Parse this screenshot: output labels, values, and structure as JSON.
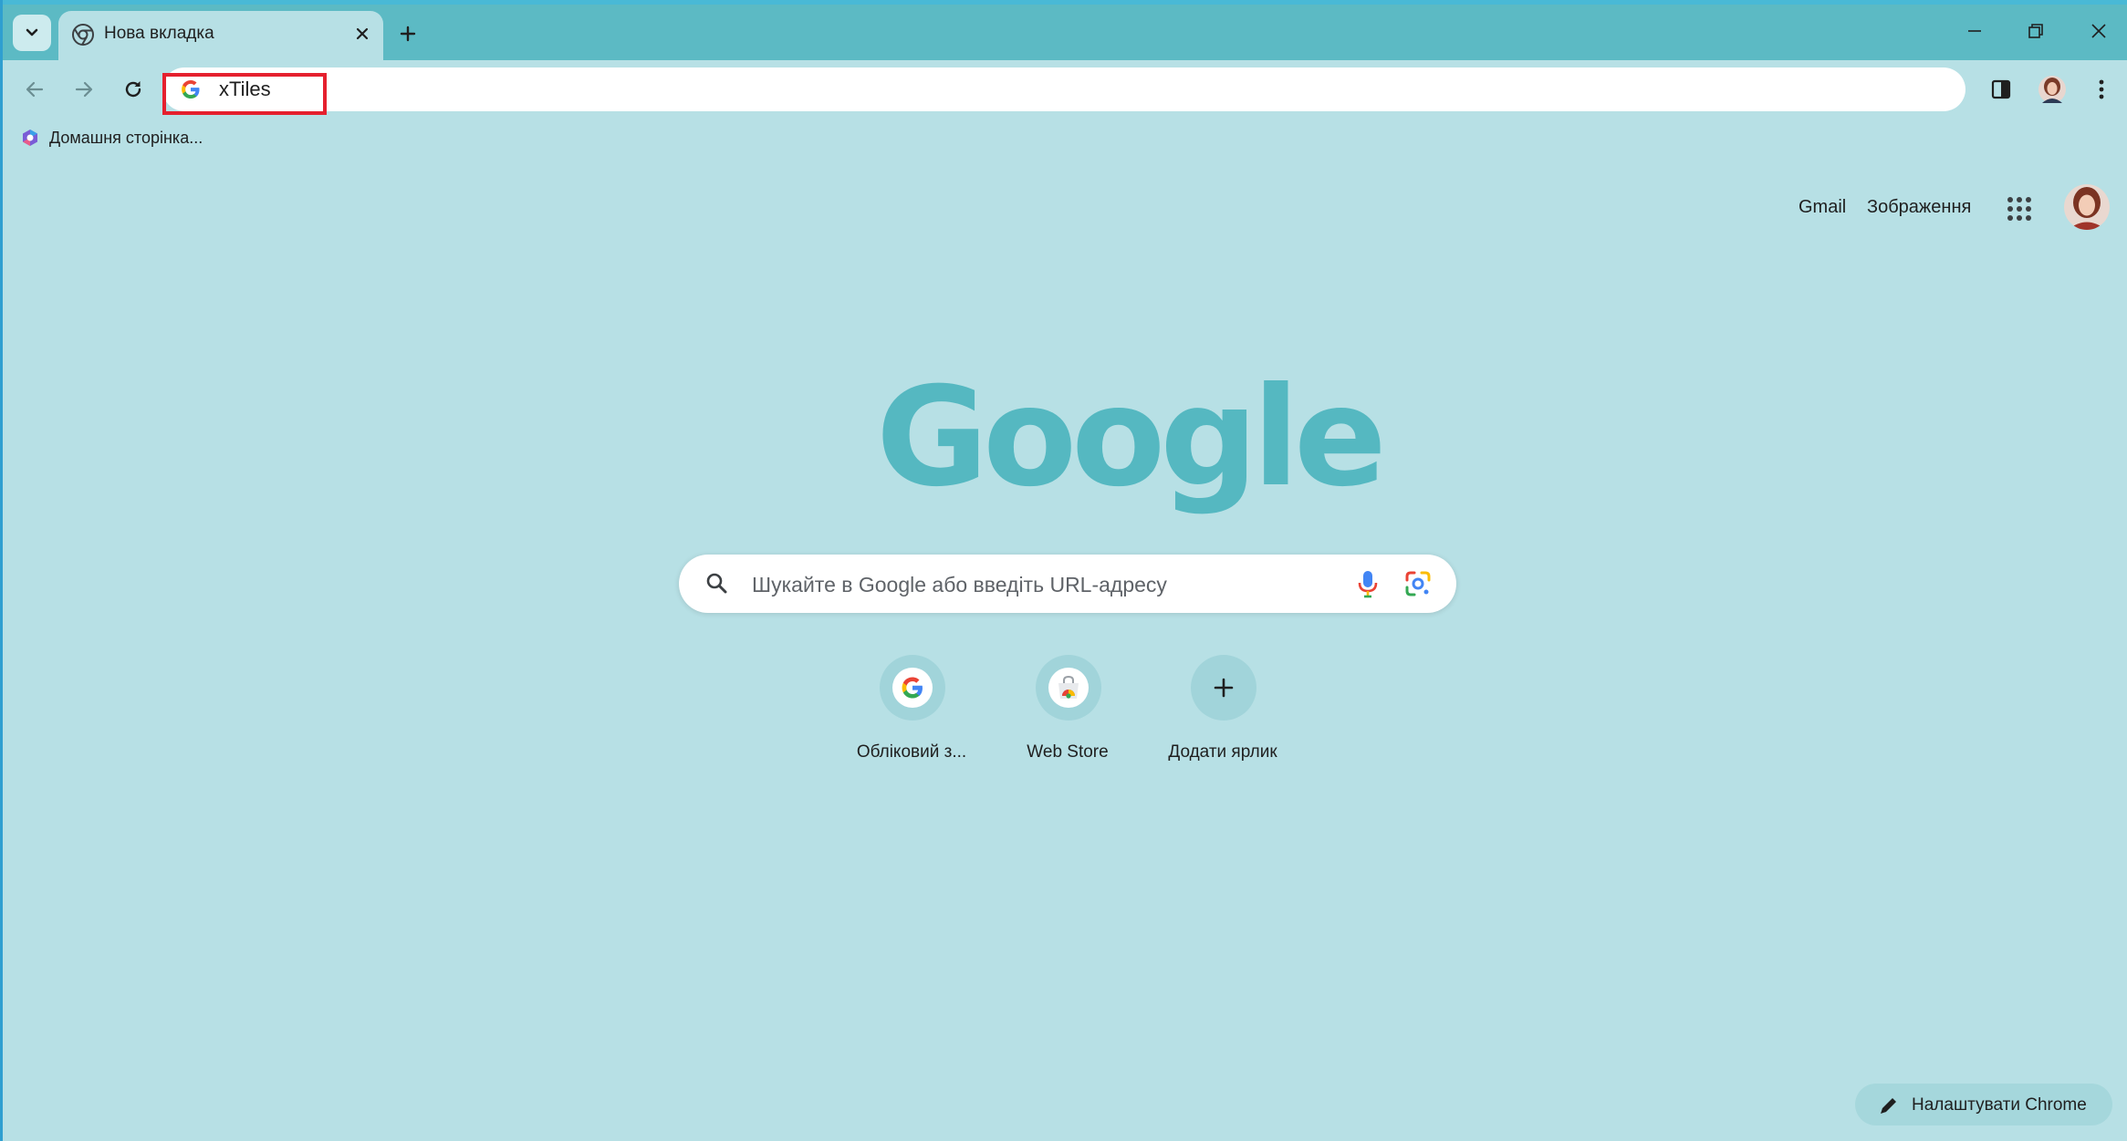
{
  "browser": {
    "tab": {
      "title": "Нова вкладка",
      "favicon": "chrome-icon"
    },
    "address_bar": {
      "value": "xTiles",
      "favicon": "google-g-icon"
    },
    "bookmarks": [
      {
        "label": "Домашня сторінка...",
        "icon": "microsoft-365-icon"
      }
    ],
    "window_controls": [
      "minimize-icon",
      "restore-icon",
      "close-icon"
    ],
    "toolbar_icons": [
      "side-panel-icon",
      "profile-avatar",
      "kebab-menu-icon"
    ]
  },
  "google_header": {
    "gmail": "Gmail",
    "images": "Зображення",
    "apps_icon": "apps-grid-icon"
  },
  "logo": {
    "text": "Google"
  },
  "search": {
    "placeholder": "Шукайте в Google або введіть URL-адресу",
    "icons": [
      "search-icon",
      "mic-icon",
      "google-lens-icon"
    ]
  },
  "shortcuts": [
    {
      "label": "Обліковий з...",
      "icon": "google-g-icon"
    },
    {
      "label": "Web Store",
      "icon": "chrome-web-store-icon"
    },
    {
      "label": "Додати ярлик",
      "icon": "plus-icon"
    }
  ],
  "customize": {
    "label": "Налаштувати Chrome",
    "icon": "pencil-icon"
  },
  "colors": {
    "background": "#b7e0e5",
    "tabstrip": "#5cbac4",
    "logo": "#55b8c1",
    "highlight": "#e5202e"
  }
}
